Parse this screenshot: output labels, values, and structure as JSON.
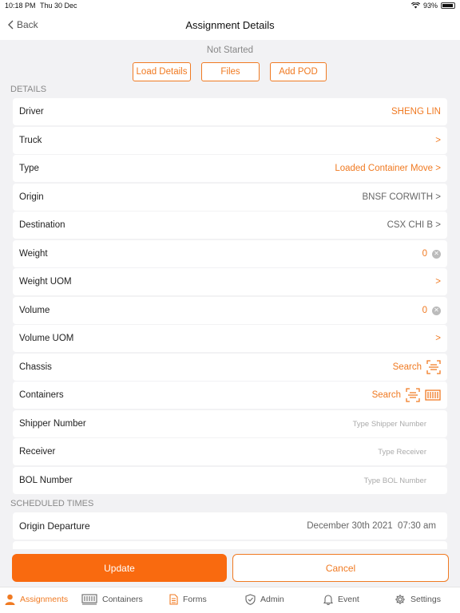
{
  "status_bar": {
    "time": "10:18 PM",
    "date": "Thu 30 Dec",
    "battery": "93%",
    "battery_level": 0.93
  },
  "nav": {
    "back_label": "Back",
    "title": "Assignment Details"
  },
  "assignment_status": "Not Started",
  "actions": {
    "load_details": "Load Details",
    "files": "Files",
    "add_pod": "Add POD"
  },
  "details": {
    "header": "DETAILS",
    "rows": {
      "driver": {
        "label": "Driver",
        "value": "SHENG LIN"
      },
      "truck": {
        "label": "Truck",
        "value": ">"
      },
      "type": {
        "label": "Type",
        "value": "Loaded Container Move >"
      },
      "origin": {
        "label": "Origin",
        "value": "BNSF CORWITH >"
      },
      "destination": {
        "label": "Destination",
        "value": "CSX CHI B >"
      },
      "weight": {
        "label": "Weight",
        "value": "0"
      },
      "weight_uom": {
        "label": "Weight UOM",
        "value": ">"
      },
      "volume": {
        "label": "Volume",
        "value": "0"
      },
      "volume_uom": {
        "label": "Volume UOM",
        "value": ">"
      },
      "chassis": {
        "label": "Chassis",
        "value": "Search"
      },
      "containers": {
        "label": "Containers",
        "value": "Search"
      },
      "shipper_number": {
        "label": "Shipper Number",
        "placeholder": "Type Shipper Number"
      },
      "receiver": {
        "label": "Receiver",
        "placeholder": "Type Receiver"
      },
      "bol_number": {
        "label": "BOL Number",
        "placeholder": "Type BOL Number"
      }
    }
  },
  "scheduled": {
    "header": "SCHEDULED TIMES",
    "origin_departure": {
      "label": "Origin Departure",
      "value": "December 30th 2021  07:30 am"
    }
  },
  "buttons": {
    "update": "Update",
    "cancel": "Cancel"
  },
  "tabs": {
    "assignments": "Assignments",
    "containers": "Containers",
    "forms": "Forms",
    "admin": "Admin",
    "event": "Event",
    "settings": "Settings"
  },
  "colors": {
    "accent": "#f07a22",
    "background": "#f2f2f4"
  }
}
